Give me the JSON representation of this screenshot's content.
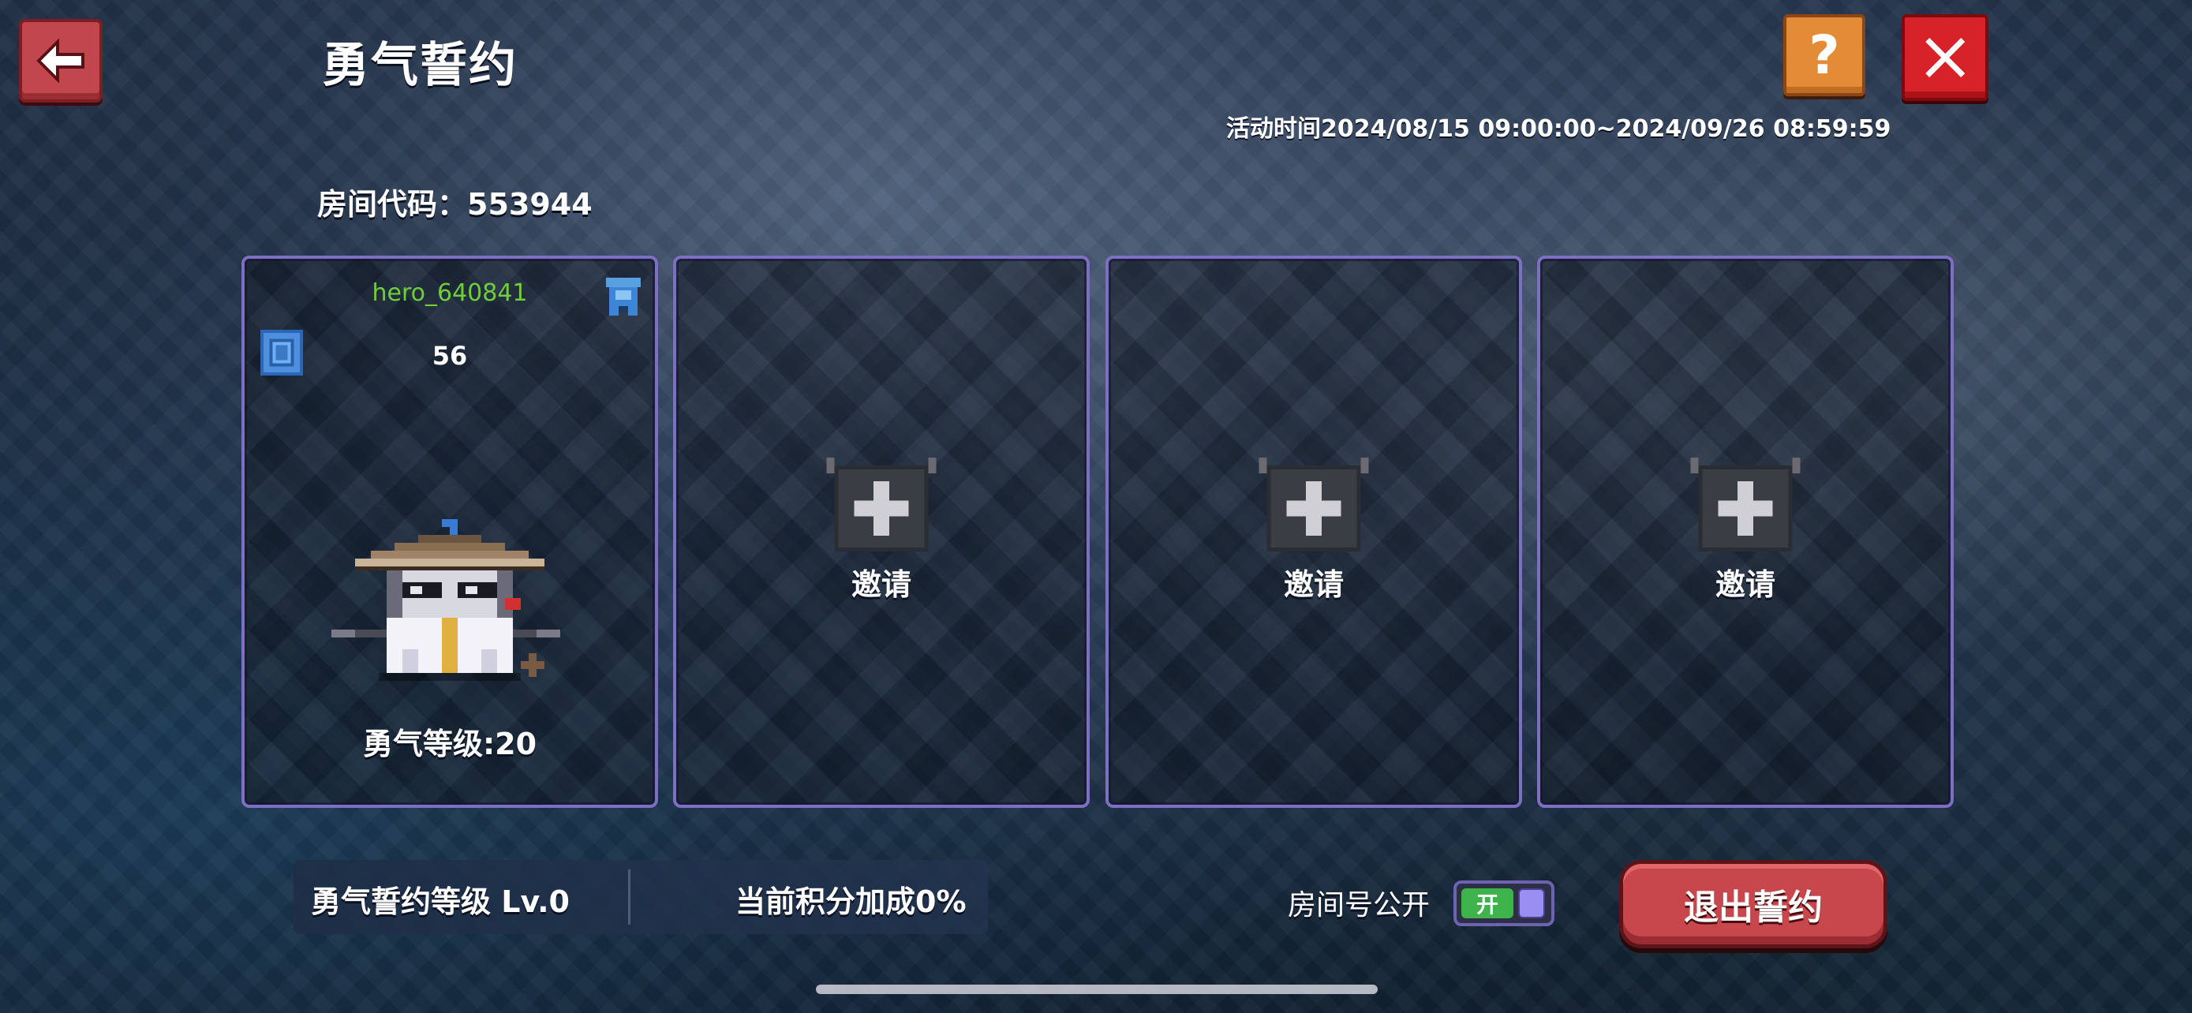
{
  "header": {
    "title": "勇气誓约",
    "event_time": "活动时间2024/08/15 09:00:00~2024/09/26 08:59:59",
    "help_label": "?"
  },
  "room": {
    "code_label": "房间代码：553944"
  },
  "slots": [
    {
      "player_name": "hero_640841",
      "level": "56",
      "courage_level": "勇气等级:20"
    },
    {
      "invite_label": "邀请"
    },
    {
      "invite_label": "邀请"
    },
    {
      "invite_label": "邀请"
    }
  ],
  "footer": {
    "vow_level": "勇气誓约等级 Lv.0",
    "bonus": "当前积分加成0%",
    "room_public_label": "房间号公开",
    "toggle_state": "开",
    "quit_label": "退出誓约"
  },
  "colors": {
    "slot_border": "#7d6fc2",
    "player_name": "#6fcf3a",
    "toggle_on": "#3db34a",
    "quit_button": "#c7474d",
    "close_button": "#d8222a",
    "help_button": "#e48b38"
  },
  "icons": {
    "back": "arrow-left-icon",
    "help": "question-mark-icon",
    "close": "close-x-icon",
    "flag": "banner-flag-icon",
    "rank": "shield-rank-icon",
    "invite": "plus-icon"
  }
}
